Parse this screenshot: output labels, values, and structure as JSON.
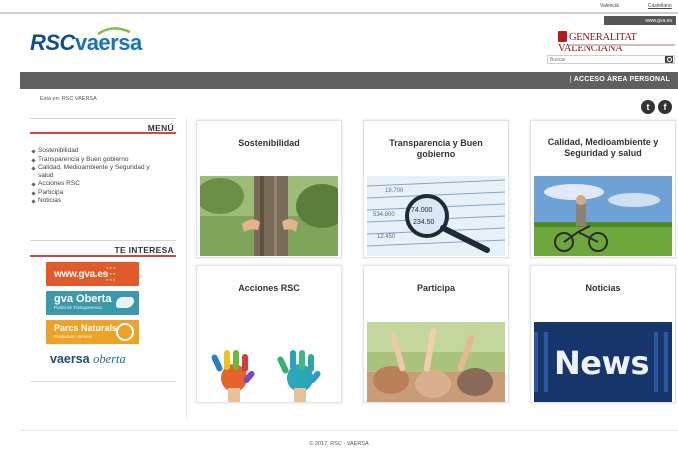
{
  "topbar": {
    "lang_valencian": "Valencià",
    "lang_castellano": "Castellano",
    "gva_link": "www.gva.es"
  },
  "logo": {
    "rsc": "RSC",
    "vaersa": "vaersa"
  },
  "generalitat": {
    "text": "GENERALITAT VALENCIANA"
  },
  "search": {
    "placeholder": "Buscar"
  },
  "nav": {
    "separator": "|",
    "acceso": "ACCESO ÁREA PERSONAL"
  },
  "breadcrumb": "Está en: RSC VAERSA",
  "social": {
    "twitter_glyph": "t",
    "facebook_glyph": "f"
  },
  "sidebar": {
    "menu_title": "MENÚ",
    "items": [
      "Sostenibilidad",
      "Transparencia y Buen gobierno",
      "Calidad, Medioambiente y Seguridad y salud",
      "Acciones RSC",
      "Participa",
      "Noticias"
    ],
    "te_interesa_title": "TE INTERESA",
    "banners": {
      "gva": "www.gva.es",
      "gva_oberta": "gva Oberta",
      "gva_oberta_sub": "Portal de Transparencia",
      "parcs": "Parcs Naturals",
      "parcs_sub": "Productes i serveis",
      "vaersa": "vaersa",
      "oberta": "oberta"
    }
  },
  "cards": [
    {
      "title": "Sostenibilidad"
    },
    {
      "title": "Transparencia y Buen gobierno"
    },
    {
      "title": "Calidad, Medioambiente y Seguridad y salud"
    },
    {
      "title": "Acciones RSC"
    },
    {
      "title": "Participa"
    },
    {
      "title": "Noticias"
    }
  ],
  "news_word": "News",
  "footer": "© 2017, RSC - VAERSA",
  "colors": {
    "navbar": "#5f5f5f",
    "accent_red": "#d04545",
    "brand_blue": "#0f4e8a"
  }
}
